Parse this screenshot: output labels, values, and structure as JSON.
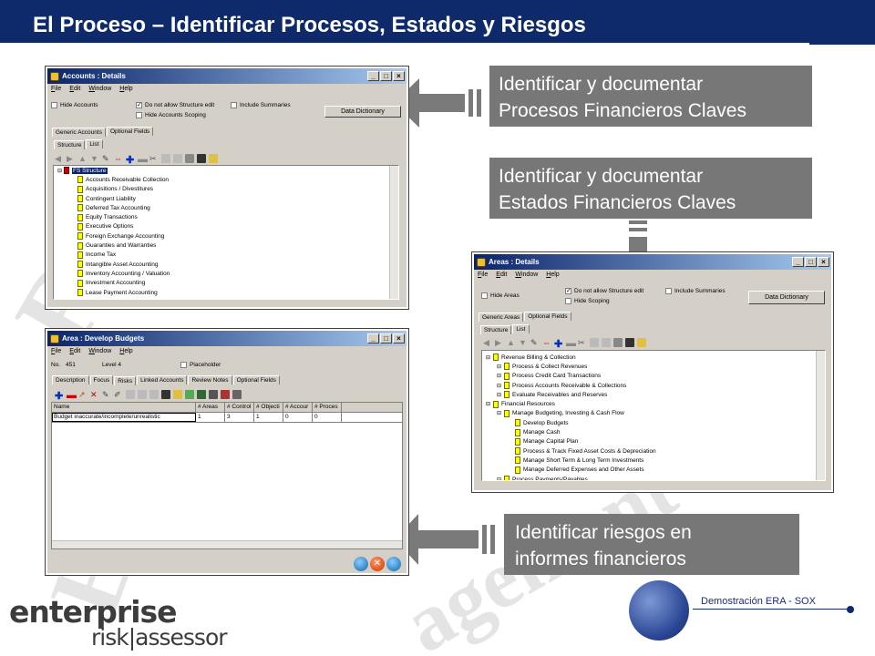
{
  "slide": {
    "title": "El Proceso – Identificar Procesos, Estados y Riesgos"
  },
  "callouts": [
    {
      "line1": "Identificar y documentar",
      "line2": "Procesos Financieros Claves"
    },
    {
      "line1": "Identificar y documentar",
      "line2": "Estados Financieros Claves"
    },
    {
      "line1": "Identificar riesgos en",
      "line2": "informes financieros"
    }
  ],
  "accounts_window": {
    "title": "Accounts : Details",
    "menu": [
      "File",
      "Edit",
      "Window",
      "Help"
    ],
    "options": {
      "hide": "Hide Accounts",
      "no_struct": "Do not allow Structure edit",
      "hide_scoping": "Hide Accounts Scoping",
      "summaries": "Include Summaries"
    },
    "data_dictionary": "Data Dictionary",
    "tabs": [
      "Generic Accounts",
      "Optional Fields"
    ],
    "subtabs": [
      "Structure",
      "List"
    ],
    "root": "FS Structure",
    "items": [
      "Accounts Receivable Collection",
      "Acquisitions / Divestitures",
      "Contingent Liability",
      "Deferred Tax Accounting",
      "Equity Transactions",
      "Executive Options",
      "Foreign Exchange Accounting",
      "Guaranties and Warranties",
      "Income Tax",
      "Intangible Asset Accounting",
      "Inventory Accounting / Valuation",
      "Investment Accounting",
      "Lease Payment Accounting"
    ]
  },
  "areas_window": {
    "title": "Areas : Details",
    "menu": [
      "File",
      "Edit",
      "Window",
      "Help"
    ],
    "options": {
      "hide": "Hide Areas",
      "no_struct": "Do not allow Structure edit",
      "hide_scoping": "Hide Scoping",
      "summaries": "Include Summaries"
    },
    "data_dictionary": "Data Dictionary",
    "tabs": [
      "Generic Areas",
      "Optional Fields"
    ],
    "subtabs": [
      "Structure",
      "List"
    ],
    "items": [
      {
        "text": "Revenue Billing & Collection",
        "level": 1
      },
      {
        "text": "Process & Collect Revenues",
        "level": 2
      },
      {
        "text": "Process Credit Card Transactions",
        "level": 2
      },
      {
        "text": "Process Accounts Receivable & Collections",
        "level": 2
      },
      {
        "text": "Evaluate Receivables and Reserves",
        "level": 2
      },
      {
        "text": "Financial Resources",
        "level": 1
      },
      {
        "text": "Manage Budgeting, Investing & Cash Flow",
        "level": 2
      },
      {
        "text": "Develop Budgets",
        "level": 3
      },
      {
        "text": "Manage Cash",
        "level": 3
      },
      {
        "text": "Manage Capital Plan",
        "level": 3
      },
      {
        "text": "Process & Track Fixed Asset Costs & Depreciation",
        "level": 3
      },
      {
        "text": "Manage Short Term & Long Term Investments",
        "level": 3
      },
      {
        "text": "Manage Deferred Expenses and Other Assets",
        "level": 3
      },
      {
        "text": "Process Payments/Payables",
        "level": 2
      }
    ]
  },
  "area_window": {
    "title": "Area : Develop Budgets",
    "menu": [
      "File",
      "Edit",
      "Window",
      "Help"
    ],
    "no_label": "No.",
    "no_value": "451",
    "level": "Level 4",
    "placeholder": "Placeholder",
    "tabs": [
      "Description",
      "Focus",
      "Risks",
      "Linked Accounts",
      "Review Notes",
      "Optional Fields"
    ],
    "columns": [
      "Name",
      "# Areas",
      "# Control",
      "# Objecti",
      "# Accour",
      "# Proces"
    ],
    "row": [
      "Budget inaccurate/incomplete/unrealistic",
      "1",
      "3",
      "1",
      "0",
      "0"
    ]
  },
  "footer": {
    "text": "Demostración ERA - SOX",
    "logo_top": "enterprise",
    "logo_bottom": "risk|assessor"
  },
  "colors": {
    "navy": "#0e2a6b",
    "callout": "#777777",
    "arrow": "#7a7a7a"
  }
}
